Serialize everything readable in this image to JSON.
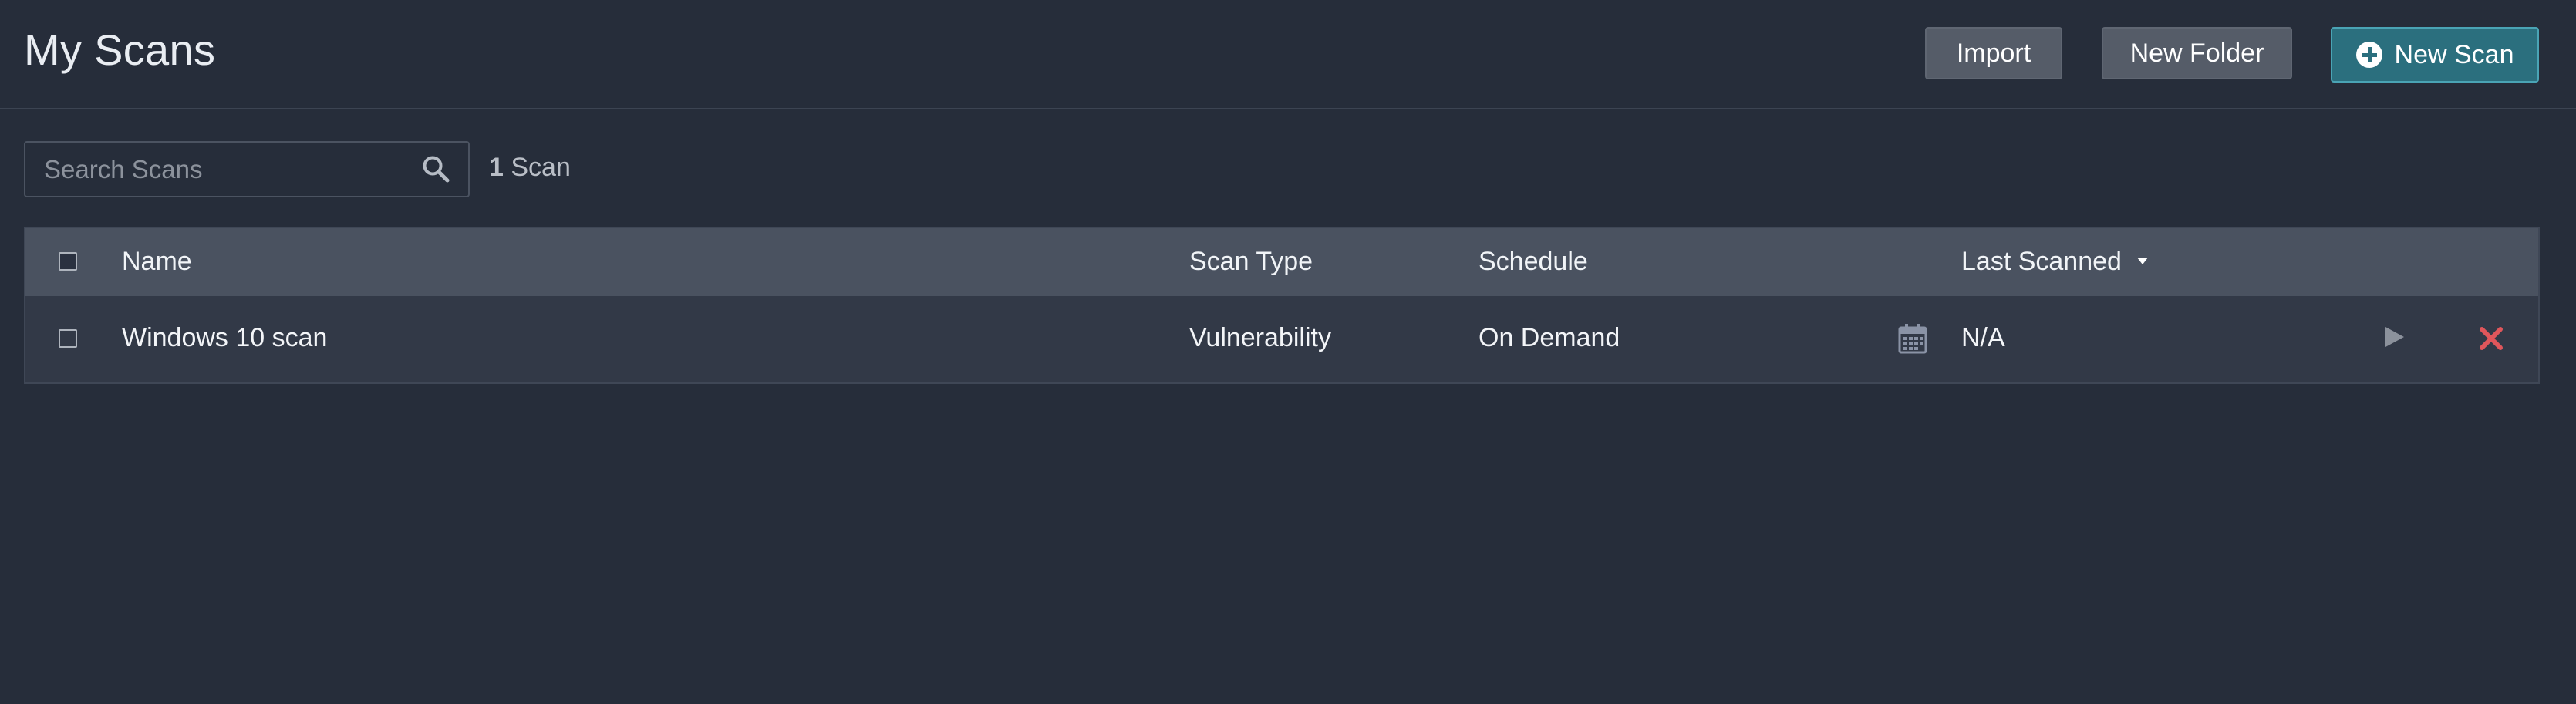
{
  "header": {
    "title": "My Scans",
    "buttons": {
      "import": "Import",
      "new_folder": "New Folder",
      "new_scan": "New Scan"
    }
  },
  "search": {
    "placeholder": "Search Scans",
    "value": ""
  },
  "scan_count": {
    "number": "1",
    "label": "Scan"
  },
  "table": {
    "columns": {
      "name": "Name",
      "scan_type": "Scan Type",
      "schedule": "Schedule",
      "last_scanned": "Last Scanned"
    },
    "sort": {
      "column": "last_scanned",
      "direction": "descending"
    },
    "rows": [
      {
        "name": "Windows 10 scan",
        "scan_type": "Vulnerability",
        "schedule": "On Demand",
        "last_scanned": "N/A"
      }
    ]
  },
  "icons": {
    "search": "search-icon",
    "new_scan": "plus-circle-icon",
    "sort": "caret-down-icon",
    "calendar": "calendar-icon",
    "launch": "play-icon",
    "delete": "close-icon"
  },
  "colors": {
    "background": "#262d3a",
    "header_row": "#4a5260",
    "data_row": "#323947",
    "primary_button": "#2b6f7e",
    "secondary_button": "#555c68",
    "delete": "#e0565b"
  }
}
